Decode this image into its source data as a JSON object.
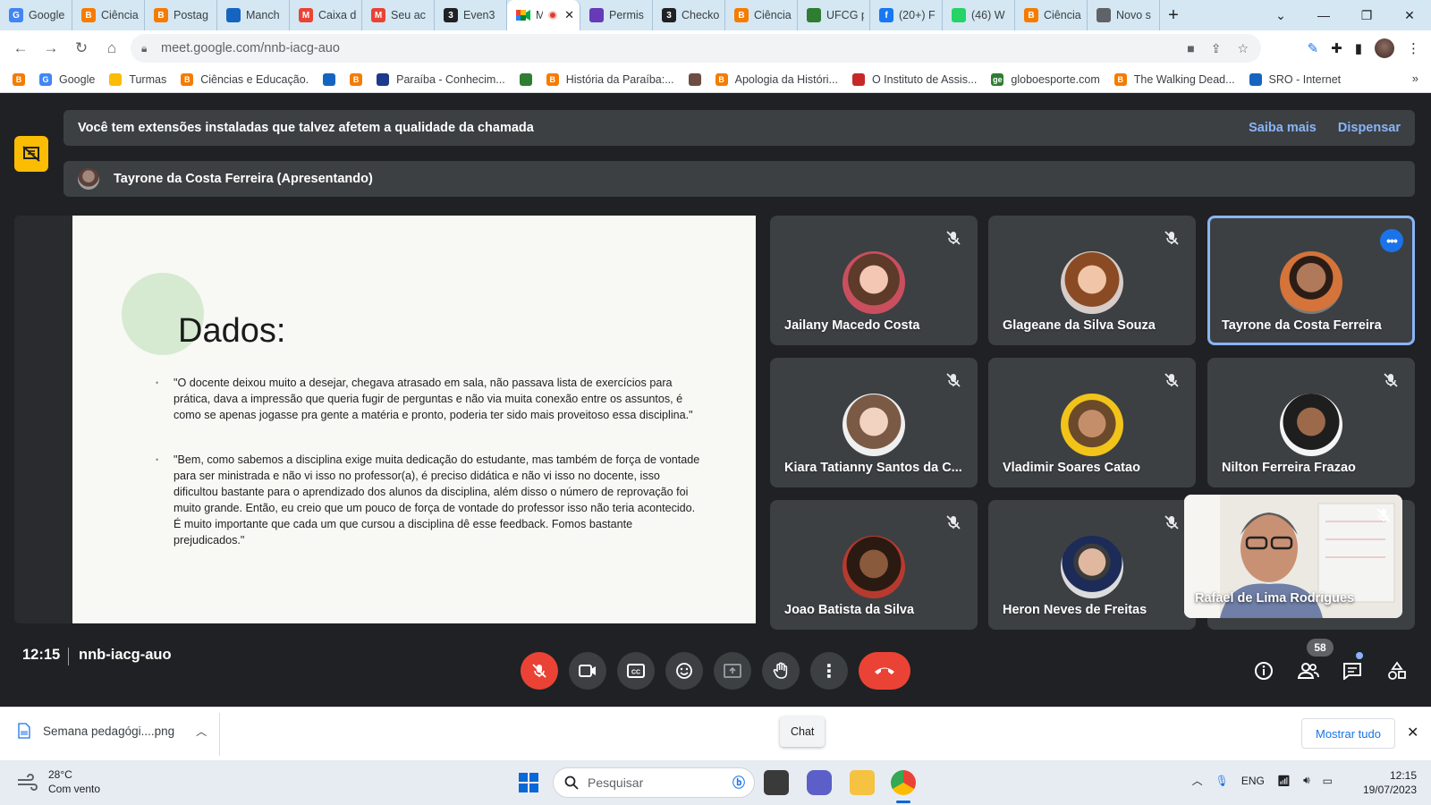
{
  "browser": {
    "tabs": [
      {
        "label": "Google",
        "fav": "G",
        "color": "#4285f4"
      },
      {
        "label": "Ciência",
        "fav": "B",
        "color": "#f57c00"
      },
      {
        "label": "Postag",
        "fav": "B",
        "color": "#f57c00"
      },
      {
        "label": "Manch",
        "fav": "",
        "color": "#1565c0"
      },
      {
        "label": "Caixa d",
        "fav": "M",
        "color": "#ea4335"
      },
      {
        "label": "Seu ac",
        "fav": "M",
        "color": "#ea4335"
      },
      {
        "label": "Even3",
        "fav": "3",
        "color": "#202124"
      }
    ],
    "active_tab": {
      "label": "M"
    },
    "tabs_after": [
      {
        "label": "Permis",
        "fav": "",
        "color": "#673ab7"
      },
      {
        "label": "Checko",
        "fav": "3",
        "color": "#202124"
      },
      {
        "label": "Ciência",
        "fav": "B",
        "color": "#f57c00"
      },
      {
        "label": "UFCG p",
        "fav": "",
        "color": "#2e7d32"
      },
      {
        "label": "(20+) F",
        "fav": "f",
        "color": "#1877f2"
      },
      {
        "label": "(46) W",
        "fav": "",
        "color": "#25d366"
      },
      {
        "label": "Ciência",
        "fav": "B",
        "color": "#f57c00"
      },
      {
        "label": "Novo s",
        "fav": "",
        "color": "#5f6368"
      }
    ],
    "url": "meet.google.com/nnb-iacg-auo",
    "bookmarks": [
      {
        "label": "",
        "fav": "B",
        "color": "#f57c00"
      },
      {
        "label": "Google",
        "fav": "G",
        "color": "#4285f4"
      },
      {
        "label": "Turmas",
        "fav": "",
        "color": "#fbbc04"
      },
      {
        "label": "Ciências e Educação.",
        "fav": "B",
        "color": "#f57c00"
      },
      {
        "label": "",
        "fav": "",
        "color": "#1565c0"
      },
      {
        "label": "",
        "fav": "B",
        "color": "#f57c00"
      },
      {
        "label": "Paraíba - Conhecim...",
        "fav": "",
        "color": "#1e3a8a"
      },
      {
        "label": "",
        "fav": "",
        "color": "#2e7d32"
      },
      {
        "label": "História da Paraíba:...",
        "fav": "B",
        "color": "#f57c00"
      },
      {
        "label": "",
        "fav": "",
        "color": "#6d4c41"
      },
      {
        "label": "Apologia da Históri...",
        "fav": "B",
        "color": "#f57c00"
      },
      {
        "label": "O Instituto de Assis...",
        "fav": "",
        "color": "#c62828"
      },
      {
        "label": "globoesporte.com",
        "fav": "ge",
        "color": "#2e7d32"
      },
      {
        "label": "The Walking Dead...",
        "fav": "B",
        "color": "#f57c00"
      },
      {
        "label": "SRO - Internet",
        "fav": "",
        "color": "#1565c0"
      }
    ],
    "bookmarks_more": "»"
  },
  "meet": {
    "extension_banner": {
      "text": "Você tem extensões instaladas que talvez afetem a qualidade da chamada",
      "learn_more": "Saiba mais",
      "dismiss": "Dispensar"
    },
    "presenting_label": "Tayrone da Costa Ferreira (Apresentando)",
    "slide": {
      "title": "Dados:",
      "quote1": "\"O docente deixou muito a desejar, chegava atrasado em sala, não passava lista de exercícios para prática, dava a impressão que queria fugir de perguntas e não via muita conexão entre os assuntos, é como se apenas jogasse pra gente a matéria e pronto, poderia ter sido mais proveitoso essa disciplina.\"",
      "quote2": "\"Bem, como sabemos a disciplina exige muita dedicação do estudante, mas também de força de vontade para ser ministrada e não vi isso no professor(a), é preciso didática e não vi isso no docente, isso dificultou bastante para o aprendizado dos alunos da disciplina, além disso o número de reprovação foi muito grande. Então, eu creio que um pouco de força de vontade do professor isso não teria acontecido. É muito importante que cada um que cursou a disciplina dê esse feedback. Fomos bastante prejudicados.\""
    },
    "participants": [
      {
        "name": "Jailany Macedo Costa"
      },
      {
        "name": "Glageane da Silva Souza"
      },
      {
        "name": "Tayrone da Costa Ferreira"
      },
      {
        "name": "Kiara Tatianny Santos da C..."
      },
      {
        "name": "Vladimir Soares Catao"
      },
      {
        "name": "Nilton Ferreira Frazao"
      },
      {
        "name": "Joao Batista da Silva"
      },
      {
        "name": "Heron Neves de Freitas"
      }
    ],
    "self_view_name": "Rafael de Lima Rodrigues",
    "time": "12:15",
    "meeting_code": "nnb-iacg-auo",
    "participant_count": "58"
  },
  "downloads": {
    "file": "Semana pedagógi....png",
    "tooltip": "Chat",
    "show_all": "Mostrar tudo"
  },
  "taskbar": {
    "temp": "28°C",
    "weather": "Com vento",
    "search_placeholder": "Pesquisar",
    "lang": "ENG",
    "time": "12:15",
    "date": "19/07/2023"
  }
}
